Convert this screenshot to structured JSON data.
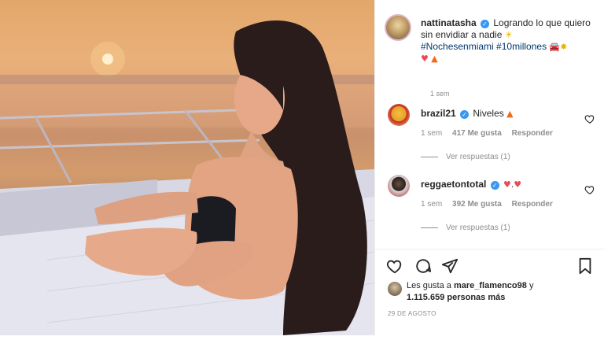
{
  "post": {
    "author": "nattinatasha",
    "caption_text_1": "Logrando lo que quiero sin envidiar a nadie",
    "hashtags": "#Nochesenmiami #10millones",
    "time_ago": "1 sem"
  },
  "comments": [
    {
      "user": "brazil21",
      "text": "Niveles",
      "time": "1 sem",
      "likes": "417 Me gusta",
      "reply_label": "Responder",
      "view_replies": "Ver respuestas (1)"
    },
    {
      "user": "reggaetontotal",
      "text": ".",
      "time": "1 sem",
      "likes": "392 Me gusta",
      "reply_label": "Responder",
      "view_replies": "Ver respuestas (1)"
    }
  ],
  "likes_section": {
    "prefix": "Les gusta a",
    "user": "mare_flamenco98",
    "conj": "y",
    "count": "1.115.659 personas más"
  },
  "date": "29 DE AGOSTO",
  "colors": {
    "verified": "#3897f0",
    "hashtag": "#00376b",
    "muted": "#8e8e8e",
    "heart_red": "#ed4956"
  },
  "icons": [
    "verified-icon",
    "heart-icon",
    "comment-icon",
    "share-icon",
    "bookmark-icon",
    "sun-emoji",
    "fire-emoji",
    "car-emoji"
  ]
}
